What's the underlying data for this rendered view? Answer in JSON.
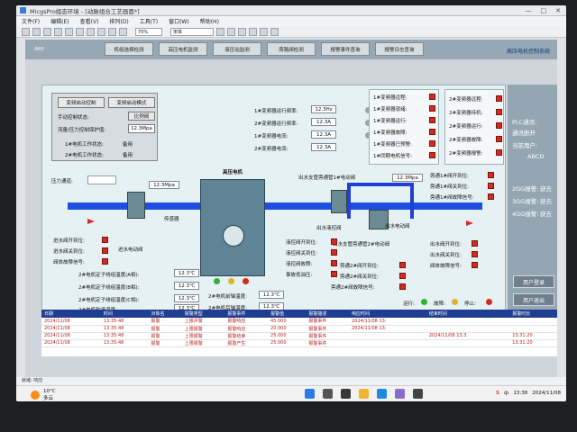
{
  "window": {
    "title": "MicgsPro组态环境 - [动脉组合工艺画面*]",
    "controls": [
      "—",
      "□",
      "✕"
    ]
  },
  "menu": [
    "文件(F)",
    "编辑(E)",
    "查看(V)",
    "排列(D)",
    "工具(T)",
    "窗口(W)",
    "帮助(H)"
  ],
  "toolbar": {
    "zoom": "70%",
    "font": "宋体"
  },
  "nav": {
    "left_tag": "ANY",
    "buttons": [
      "机组选择检测",
      "高压电机监测",
      "液压站监测",
      "旁路阀检测",
      "报警事件查询",
      "报警日志查询"
    ],
    "right_title": "高压电机控制系统"
  },
  "control": {
    "buttons": [
      "变频启动控制",
      "变频启动模式"
    ],
    "rows": [
      {
        "label": "手动控制状态:",
        "value": "比例阀"
      },
      {
        "label": "流量/压力控制保护值:",
        "value": "12.3Mpa"
      }
    ],
    "status": [
      {
        "label": "1#电机工作状态:",
        "value": "备用"
      },
      {
        "label": "2#电机工作状态:",
        "value": "备用"
      }
    ]
  },
  "freq": {
    "rows": [
      {
        "label": "1#变频器运行频率:",
        "value": "12.3Hz"
      },
      {
        "label": "2#变频器运行频率:",
        "value": "12.3A"
      },
      {
        "label": "1#变频器电流:",
        "value": "12.3A"
      },
      {
        "label": "2#变频器电流:",
        "value": "12.3A"
      }
    ]
  },
  "vfd1": [
    "1#变频器远程:",
    "1#变频器就绪:",
    "1#变频器运行:",
    "1#变频器故障:",
    "1#变频器已预警:",
    "1#同期电机信号:"
  ],
  "vfd2": [
    "2#变频器远程:",
    "2#变频器待机:",
    "2#变频器运行:",
    "2#变频器故障:",
    "2#变频器报警:"
  ],
  "process": {
    "pressure_label": "压力通道:",
    "pressure_left": "12.3Mpa",
    "pressure_right": "12.3Mpa",
    "motor_title": "高压电机",
    "sensor_label": "传感器",
    "bypass_valve_title": "出水支管旁通管1#电动阀",
    "outlet_motor_valve": "出水电动阀",
    "outlet_hydraulic_valve": "出水液控阀",
    "bypass_pipe_valve": "出水支管旁通管2#电动阀",
    "inlet_motor_valve": "进水电动阀"
  },
  "inlet_status": [
    "进水阀开到位:",
    "进水阀关到位:",
    "阀体故障信号:"
  ],
  "temps": [
    {
      "label": "2#电机定子绕组温度(A相):",
      "value": "12.3℃"
    },
    {
      "label": "2#电机定子绕组温度(B相):",
      "value": "12.3℃"
    },
    {
      "label": "2#电机定子绕组温度(C相):",
      "value": "12.3℃"
    },
    {
      "label": "2#电机轴承温度:",
      "value": "12.3℃"
    }
  ],
  "motor_temps": [
    {
      "label": "2#电机前轴温度:",
      "value": "12.3℃"
    },
    {
      "label": "2#电机后轴温度:",
      "value": "12.3℃"
    }
  ],
  "hydraulic": [
    "液控阀开到位:",
    "液控阀关到位:",
    "液控阀故障:",
    "事故低油压:"
  ],
  "bypass2": [
    "旁通2#阀开到位:",
    "旁通2#阀关到位:",
    "旁通2#阀故障信号:"
  ],
  "bypass1": [
    "旁通1#阀开到位:",
    "旁通1#阀关到位:",
    "旁通1#阀故障信号:"
  ],
  "outlet_valve_status": [
    "出水阀开到位:",
    "出水阀关到位:",
    "阀体故障信号:"
  ],
  "legend": [
    {
      "label": "运行:",
      "color": "#2db32d"
    },
    {
      "label": "故障:",
      "color": "#e1b12c"
    },
    {
      "label": "停止:",
      "color": "#d52a1f"
    }
  ],
  "right_panel": {
    "plc_label": "PLC通讯:",
    "plc_status": "通讯断开",
    "user_label": "当前用户:",
    "user_value": "ABCD",
    "alarms": [
      {
        "label": "2GG报警:",
        "value": "获去"
      },
      {
        "label": "3GG报警:",
        "value": "获去"
      },
      {
        "label": "4GG报警:",
        "value": "获去"
      }
    ],
    "login": "用户登录",
    "logout": "用户退出"
  },
  "alarm_table": {
    "headers": [
      "日期",
      "时间",
      "对象名",
      "报警类型",
      "报警事件",
      "报警值",
      "报警描述",
      "响应时间",
      "结束时间",
      "报警时长"
    ],
    "rows": [
      [
        "2024/11/08",
        "13:35:48",
        "报警",
        "上报并警",
        "报警响应",
        "45.000",
        "报警事件",
        "2024/11/08 13:",
        "",
        ""
      ],
      [
        "2024/11/08",
        "13:35:48",
        "报警",
        "上限报警",
        "报警响应",
        "20.000",
        "报警事件",
        "2024/11/08 13:",
        "",
        ""
      ],
      [
        "2024/11/08",
        "13:35:48",
        "报警",
        "上限报警",
        "报警结束",
        "25.000",
        "报警事件",
        "",
        "2024/11/08 13:3",
        "13:31:20"
      ],
      [
        "2024/11/08",
        "13:35:48",
        "报警",
        "上限报警",
        "报警产生",
        "25.000",
        "报警事件",
        "",
        "",
        "13:31:20"
      ]
    ]
  },
  "statusbar": "就绪: 响应",
  "taskbar": {
    "temp": "10°C",
    "weather": "多云",
    "ime": "中",
    "time": "13:38",
    "date": "2024/11/08"
  }
}
